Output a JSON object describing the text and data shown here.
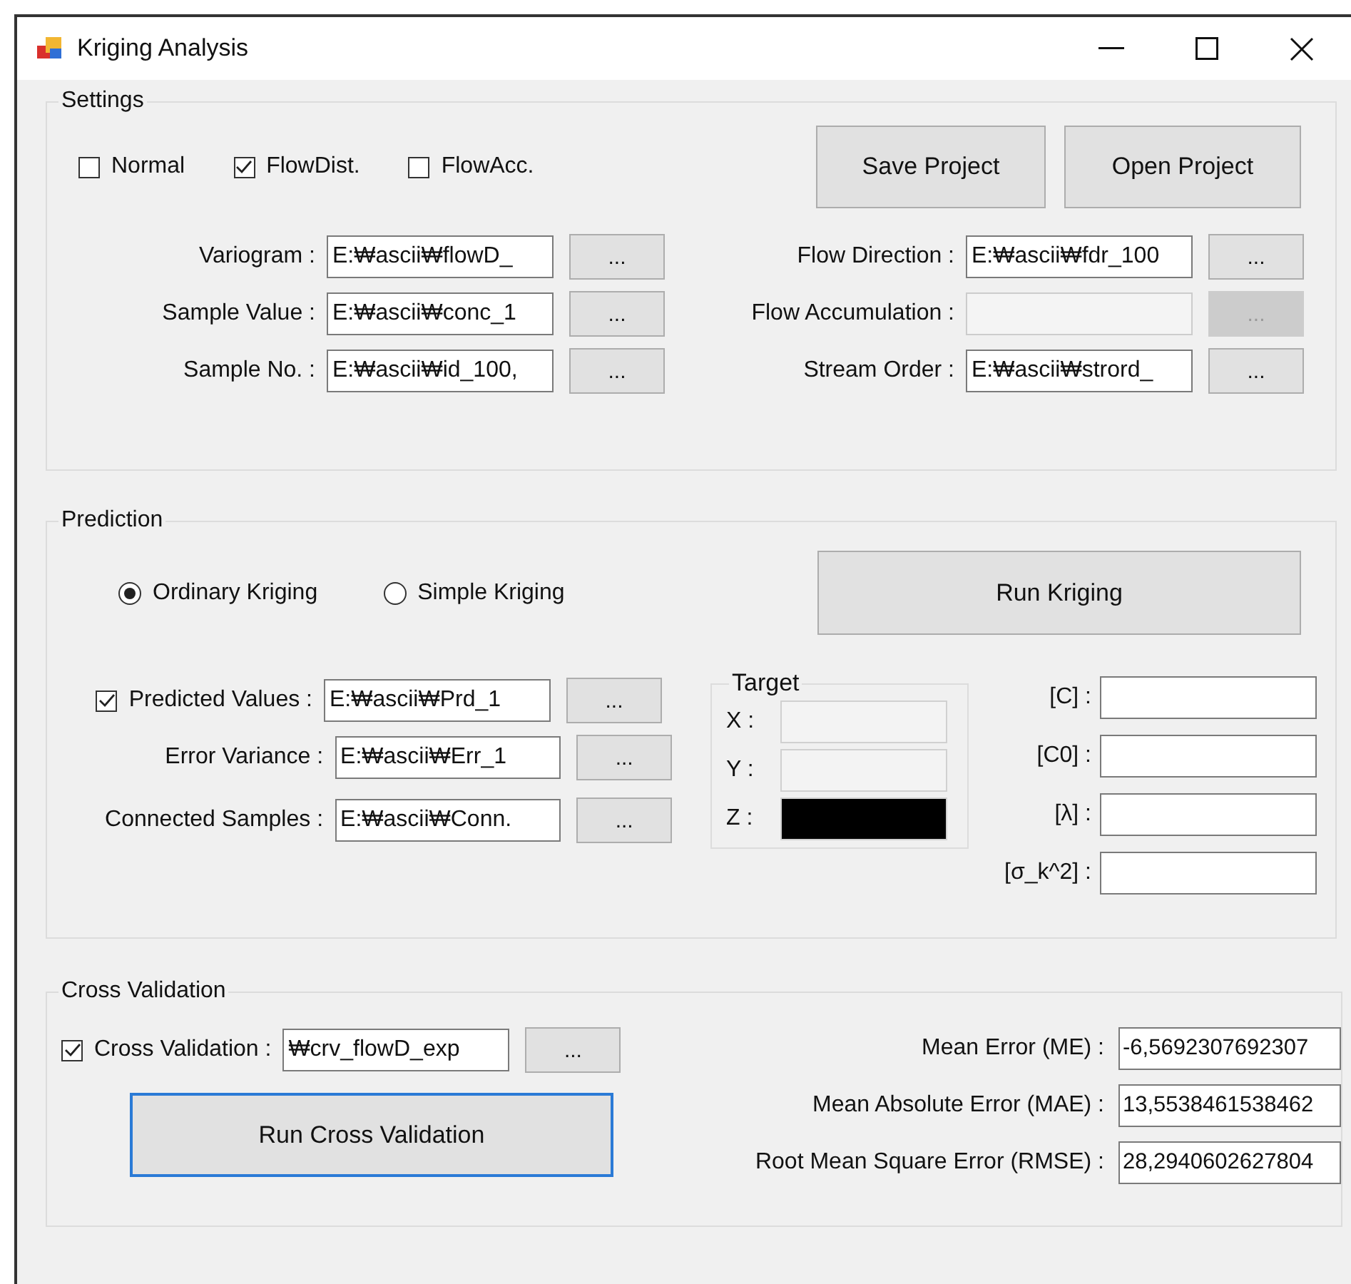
{
  "window": {
    "title": "Kriging Analysis"
  },
  "settings": {
    "title": "Settings",
    "options": [
      {
        "label": "Normal",
        "checked": false
      },
      {
        "label": "FlowDist.",
        "checked": true
      },
      {
        "label": "FlowAcc.",
        "checked": false
      }
    ],
    "buttons": [
      "Save Project",
      "Open Project"
    ],
    "left_fields": [
      {
        "label": "Variogram :",
        "value": "E:₩ascii₩flowD_",
        "disabled": false
      },
      {
        "label": "Sample Value :",
        "value": "E:₩ascii₩conc_1",
        "disabled": false
      },
      {
        "label": "Sample No. :",
        "value": "E:₩ascii₩id_100,",
        "disabled": false
      }
    ],
    "right_fields": [
      {
        "label": "Flow Direction :",
        "value": "E:₩ascii₩fdr_100",
        "disabled": false
      },
      {
        "label": "Flow Accumulation :",
        "disabled": true
      },
      {
        "label": "Stream Order :",
        "value": "E:₩ascii₩strord_",
        "disabled": false
      }
    ],
    "browse_label": "..."
  },
  "prediction": {
    "title": "Prediction",
    "methods": [
      {
        "label": "Ordinary Kriging",
        "selected": true
      },
      {
        "label": "Simple Kriging",
        "selected": false
      }
    ],
    "run_button": "Run Kriging",
    "outputs": [
      {
        "kind": "checkbox",
        "label": "Predicted Values :",
        "value": "E:₩ascii₩Prd_1",
        "checked": true
      },
      {
        "kind": "plain",
        "label": "Error Variance :",
        "value": "E:₩ascii₩Err_1"
      },
      {
        "kind": "plain",
        "label": "Connected Samples :",
        "value": "E:₩ascii₩Conn."
      }
    ],
    "target": {
      "title": "Target",
      "coords": [
        {
          "label": "X :",
          "color": "#f3f3f3"
        },
        {
          "label": "Y :",
          "color": "#f3f3f3"
        },
        {
          "label": "Z :",
          "color": "#000000"
        }
      ]
    },
    "params": [
      {
        "label": "[C] :"
      },
      {
        "label": "[C0] :"
      },
      {
        "label": "[λ] :"
      },
      {
        "label": "[σ_k^2] :"
      }
    ]
  },
  "cross_validation": {
    "title": "Cross Validation",
    "file": {
      "label": "Cross Validation :",
      "value": "₩crv_flowD_exp",
      "checked": true
    },
    "run_button": {
      "label": "Run Cross Validation",
      "focused": true
    },
    "metrics": [
      {
        "label": "Mean Error (ME) :",
        "value": "-6,5692307692307"
      },
      {
        "label": "Mean Absolute Error (MAE) :",
        "value": "13,5538461538462"
      },
      {
        "label": "Root Mean Square Error (RMSE) :",
        "value": "28,2940602627804"
      }
    ]
  }
}
